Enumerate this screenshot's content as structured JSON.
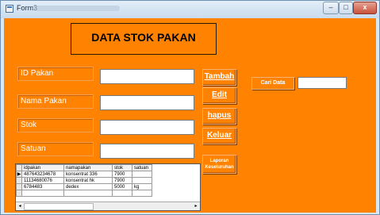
{
  "window": {
    "title": "Form3",
    "controls": {
      "minimize": "–",
      "maximize": "□",
      "close": "x"
    }
  },
  "form": {
    "heading": "DATA STOK PAKAN",
    "labels": {
      "id": "ID Pakan",
      "nama": "Nama Pakan",
      "stok": "Stok",
      "satuan": "Satuan"
    },
    "inputs": {
      "id": "",
      "nama": "",
      "stok": "",
      "satuan": ""
    },
    "buttons": {
      "tambah": "Tambah",
      "edit": "Edit",
      "hapus": "hapus",
      "keluar": "Keluar",
      "laporan": "Laporan Keseluruhan"
    },
    "cari": {
      "button": "Cari Data",
      "value": ""
    }
  },
  "grid": {
    "columns": [
      "idpakan",
      "namapakan",
      "stok",
      "satuan"
    ],
    "rows": [
      [
        "487643234678",
        "konsentrat 336",
        "7900",
        ""
      ],
      [
        "11134680076",
        "konsentrat hk",
        "7900",
        ""
      ],
      [
        "6784483",
        "dedex",
        "5000",
        "kg"
      ],
      [
        "",
        "",
        "",
        ""
      ]
    ],
    "selected_row_marker": "▶",
    "scroll_left": "◂",
    "scroll_right": "▸"
  },
  "colors": {
    "form_background": "#ff8200",
    "label_text": "#ffffff",
    "title_bar": "#d9e6f3"
  }
}
